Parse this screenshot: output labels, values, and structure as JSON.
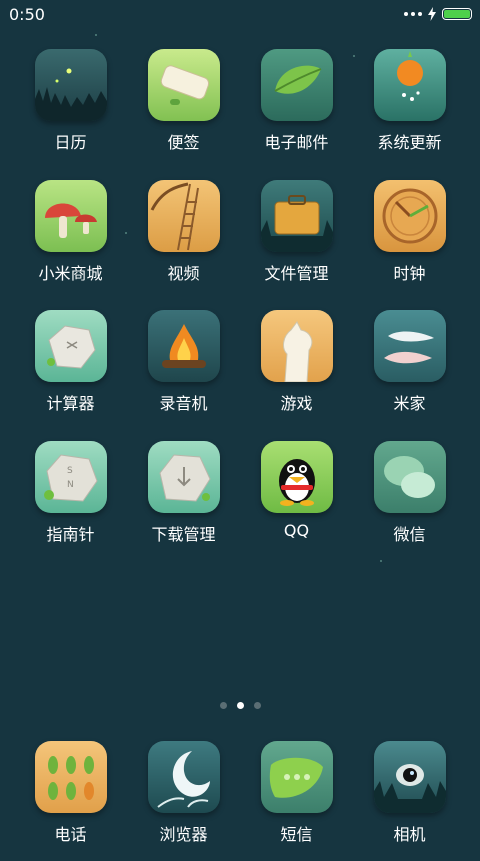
{
  "status_bar": {
    "time": "0:50",
    "more_icon": "more-dots-icon",
    "charging_icon": "lightning-icon",
    "battery_icon": "battery-icon",
    "battery_level": 1.0,
    "battery_color": "#4ed04b"
  },
  "apps": [
    {
      "label": "日历",
      "icon": "calendar-icon"
    },
    {
      "label": "便签",
      "icon": "notes-icon"
    },
    {
      "label": "电子邮件",
      "icon": "email-icon"
    },
    {
      "label": "系统更新",
      "icon": "system-update-icon"
    },
    {
      "label": "小米商城",
      "icon": "mi-store-icon"
    },
    {
      "label": "视频",
      "icon": "video-icon"
    },
    {
      "label": "文件管理",
      "icon": "file-manager-icon"
    },
    {
      "label": "时钟",
      "icon": "clock-icon"
    },
    {
      "label": "计算器",
      "icon": "calculator-icon"
    },
    {
      "label": "录音机",
      "icon": "recorder-icon"
    },
    {
      "label": "游戏",
      "icon": "games-icon"
    },
    {
      "label": "米家",
      "icon": "mijia-icon"
    },
    {
      "label": "指南针",
      "icon": "compass-icon"
    },
    {
      "label": "下载管理",
      "icon": "downloads-icon"
    },
    {
      "label": "QQ",
      "icon": "qq-icon"
    },
    {
      "label": "微信",
      "icon": "wechat-icon"
    }
  ],
  "page_indicator": {
    "pages": 3,
    "active_page": 2
  },
  "dock": [
    {
      "label": "电话",
      "icon": "phone-icon"
    },
    {
      "label": "浏览器",
      "icon": "browser-icon"
    },
    {
      "label": "短信",
      "icon": "messages-icon"
    },
    {
      "label": "相机",
      "icon": "camera-icon"
    }
  ],
  "colors": {
    "background": "#163540",
    "accent_green": "#4ed04b"
  }
}
